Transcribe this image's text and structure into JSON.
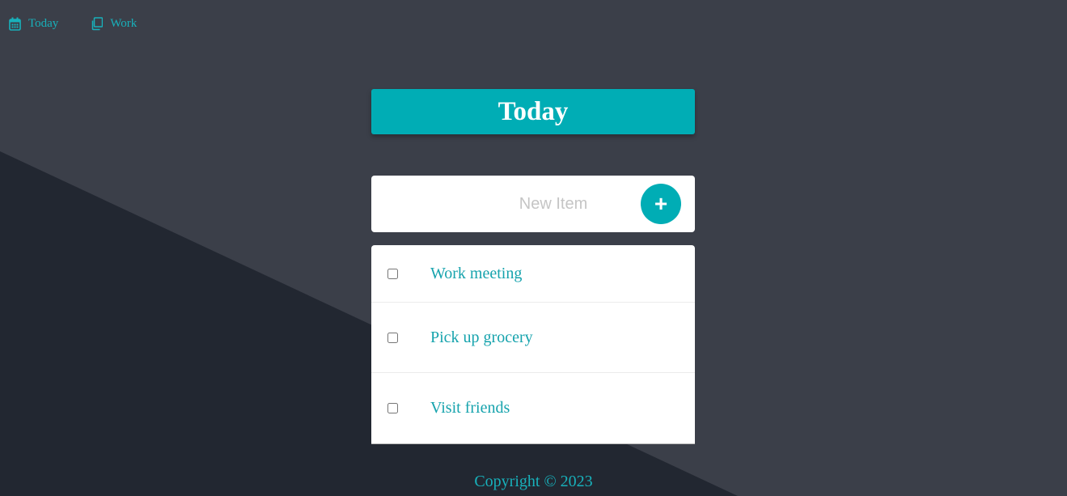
{
  "nav": {
    "items": [
      {
        "label": "Today",
        "icon": "calendar-icon"
      },
      {
        "label": "Work",
        "icon": "copy-icon"
      }
    ]
  },
  "list": {
    "title": "Today",
    "new_item_placeholder": "New Item",
    "add_label": "+",
    "items": [
      {
        "label": "Work meeting",
        "checked": false
      },
      {
        "label": "Pick up grocery",
        "checked": false
      },
      {
        "label": "Visit friends",
        "checked": false
      }
    ]
  },
  "footer": {
    "copyright": "Copyright © 2023"
  },
  "colors": {
    "accent": "#00adb5",
    "background_light": "#3b3f49",
    "background_dark": "#222731",
    "item_text": "#16a3ad"
  }
}
